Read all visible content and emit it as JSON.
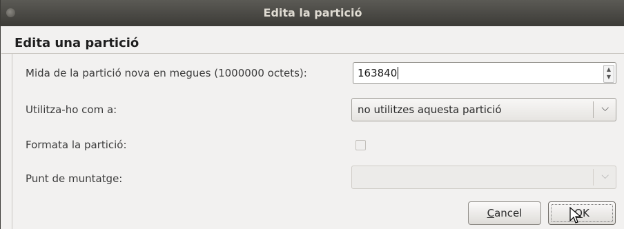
{
  "window": {
    "title": "Edita la partició"
  },
  "heading": "Edita una partició",
  "fields": {
    "size": {
      "label": "Mida de la partició nova en megues (1000000 octets):",
      "value": "163840"
    },
    "use_as": {
      "label": "Utilitza-ho com a:",
      "value": "no utilitzes aquesta partició"
    },
    "format": {
      "label": "Formata la partició:",
      "checked": false
    },
    "mount": {
      "label": "Punt de muntatge:",
      "value": ""
    }
  },
  "buttons": {
    "cancel": {
      "mnemonic": "C",
      "rest": "ancel"
    },
    "ok": {
      "mnemonic": "O",
      "rest": "K"
    }
  },
  "icons": {
    "window_menu": "window-menu-icon",
    "spin_up": "chevron-up-icon",
    "spin_down": "chevron-down-icon",
    "dropdown": "chevron-down-icon",
    "cursor": "mouse-pointer-icon"
  }
}
